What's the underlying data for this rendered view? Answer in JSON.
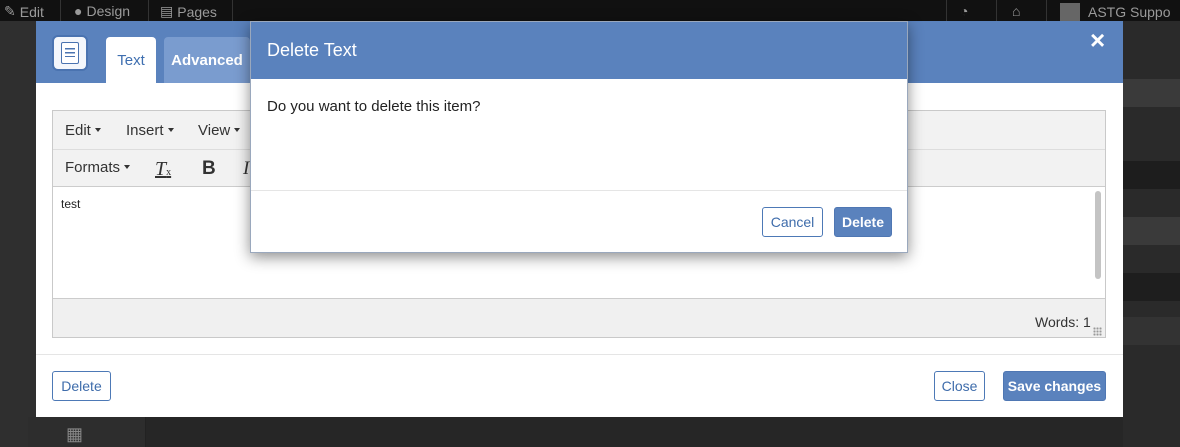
{
  "topbar": {
    "edit_label": "Edit",
    "design_label": "Design",
    "pages_label": "Pages",
    "user_label": "ASTG Suppo"
  },
  "modal": {
    "tabs": [
      {
        "label": "Text",
        "active": true
      },
      {
        "label": "Advanced",
        "active": false
      }
    ],
    "close_glyph": "×",
    "editor": {
      "menu": [
        {
          "label": "Edit"
        },
        {
          "label": "Insert"
        },
        {
          "label": "View"
        }
      ],
      "formats_label": "Formats",
      "bold_glyph": "B",
      "italic_glyph": "I",
      "content": "test",
      "word_count": "Words: 1"
    },
    "footer": {
      "delete_label": "Delete",
      "close_label": "Close",
      "save_label": "Save changes"
    }
  },
  "dialog": {
    "title": "Delete Text",
    "message": "Do you want to delete this item?",
    "cancel_label": "Cancel",
    "delete_label": "Delete"
  },
  "colors": {
    "header_blue": "#5a82bd",
    "tab_inactive": "#7a9ccf",
    "accent_text": "#3e6cab"
  }
}
